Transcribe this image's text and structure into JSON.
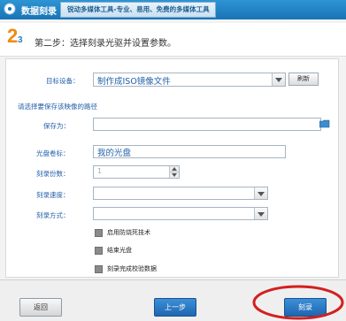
{
  "header": {
    "title": "数据刻录",
    "tagline": "锐动多媒体工具-专业、易用、免费的多媒体工具"
  },
  "step": {
    "current": "2",
    "total": "3",
    "text": "第二步：选择刻录光驱并设置参数。"
  },
  "form": {
    "target_device_label": "目标设备：",
    "target_device_value": "制作成ISO镜像文件",
    "refresh_label": "刷新",
    "save_path_hint": "请选择要保存该映像的路径",
    "save_as_label": "保存为：",
    "save_as_value": "",
    "disc_label_label": "光盘卷标：",
    "disc_label_value": "我的光盘",
    "copies_label": "刻录份数：",
    "copies_value": "1",
    "speed_label": "刻录速度：",
    "speed_value": "",
    "mode_label": "刻录方式：",
    "mode_value": "",
    "options": [
      {
        "label": "启用防烧死技术",
        "checked": false
      },
      {
        "label": "结束光盘",
        "checked": false
      },
      {
        "label": "刻录完成校验数据",
        "checked": false
      }
    ]
  },
  "buttons": {
    "back": "返回",
    "prev": "上一步",
    "burn": "刻录"
  },
  "colors": {
    "title_bar": "#1f7fc2",
    "step_number": "#f08a10",
    "label_blue": "#2360a8",
    "highlight_circle": "#d41f1f"
  }
}
